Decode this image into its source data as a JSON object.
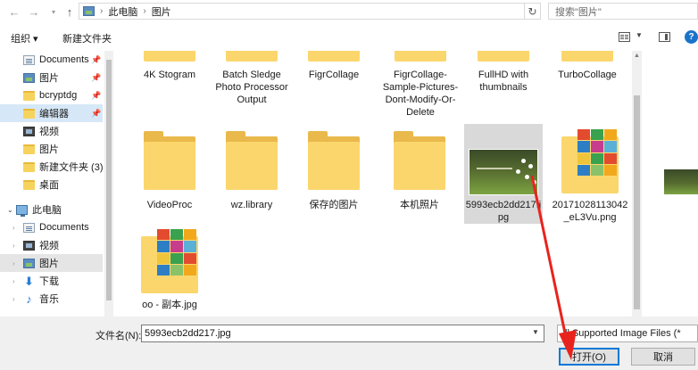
{
  "address": {
    "crumbs": [
      "此电脑",
      "图片"
    ],
    "search_placeholder": "搜索\"图片\""
  },
  "toolbar": {
    "organize_label": "组织 ▾",
    "new_folder_label": "新建文件夹"
  },
  "nav": {
    "items": [
      {
        "label": "Documents",
        "icon": "documents-icon",
        "pinned": true
      },
      {
        "label": "图片",
        "icon": "pictures-icon",
        "pinned": true
      },
      {
        "label": "bcryptdg",
        "icon": "folder-icon",
        "pinned": true
      },
      {
        "label": "编辑器",
        "icon": "folder-icon",
        "pinned": true,
        "selected": true
      },
      {
        "label": "视频",
        "icon": "video-icon"
      },
      {
        "label": "图片",
        "icon": "pictures-icon"
      },
      {
        "label": "新建文件夹 (3)",
        "icon": "folder-icon"
      },
      {
        "label": "桌面",
        "icon": "folder-icon"
      },
      {
        "label": "此电脑",
        "icon": "computer-icon",
        "expanded": true
      },
      {
        "label": "Documents",
        "icon": "documents-icon"
      },
      {
        "label": "视频",
        "icon": "video-icon"
      },
      {
        "label": "图片",
        "icon": "pictures-icon",
        "highlighted": true
      },
      {
        "label": "下载",
        "icon": "download-icon"
      },
      {
        "label": "音乐",
        "icon": "music-icon"
      }
    ]
  },
  "files": [
    {
      "label": "4K Stogram",
      "kind": "folder-stub"
    },
    {
      "label": "Batch Sledge Photo Processor Output",
      "kind": "folder-stub"
    },
    {
      "label": "FigrCollage",
      "kind": "folder-stub"
    },
    {
      "label": "FigrCollage-Sample-Pictures-Dont-Modify-Or-Delete",
      "kind": "folder-stub"
    },
    {
      "label": "FullHD with thumbnails",
      "kind": "folder-stub"
    },
    {
      "label": "TurboCollage",
      "kind": "folder-stub"
    },
    {
      "label": "VideoProc",
      "kind": "folder"
    },
    {
      "label": "wz.library",
      "kind": "folder"
    },
    {
      "label": "保存的图片",
      "kind": "folder"
    },
    {
      "label": "本机照片",
      "kind": "folder"
    },
    {
      "label": "5993ecb2dd217.jpg",
      "kind": "photo",
      "selected": true
    },
    {
      "label": "20171028113042_eL3Vu.png",
      "kind": "collage"
    },
    {
      "label": "oo - 副本.jpg",
      "kind": "collage"
    }
  ],
  "bottom": {
    "filename_label": "文件名(N):",
    "filename_value": "5993ecb2dd217.jpg",
    "filter_label": "ll Supported Image Files (*",
    "open_label": "打开(O)",
    "cancel_label": "取消"
  },
  "colors": {
    "selection": "#cce8ff",
    "nav_selection": "#d6e8f7",
    "folder": "#fbd66d",
    "accent": "#0078d7",
    "annotation_arrow": "#e8231e"
  }
}
